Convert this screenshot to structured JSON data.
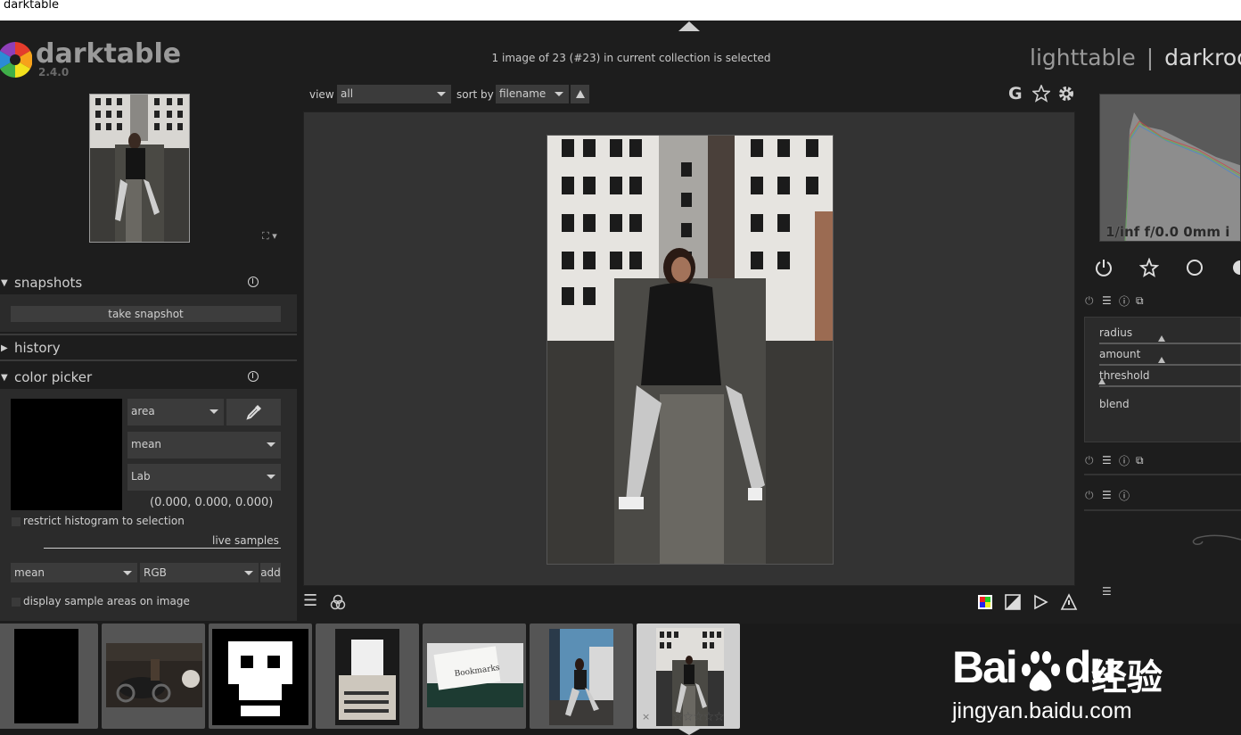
{
  "window": {
    "title": "darktable"
  },
  "header": {
    "app_name": "darktable",
    "version": "2.4.0",
    "status": "1 image of 23 (#23) in current collection is selected",
    "views": {
      "lighttable": "lighttable",
      "separator": "|",
      "darkroom": "darkroom"
    }
  },
  "left": {
    "snapshots": {
      "title": "snapshots",
      "take_snapshot": "take snapshot"
    },
    "history": {
      "title": "history"
    },
    "color_picker": {
      "title": "color picker",
      "mode": "area",
      "stat": "mean",
      "colorspace": "Lab",
      "values": "(0.000, 0.000, 0.000)",
      "restrict_label": "restrict histogram to selection",
      "live_samples": "live samples",
      "sample_stat": "mean",
      "sample_space": "RGB",
      "add": "add",
      "display_label": "display sample areas on image"
    }
  },
  "toolbar": {
    "view_label": "view",
    "view_value": "all",
    "sort_label": "sort by",
    "sort_value": "filename",
    "g_label": "G"
  },
  "right": {
    "histogram_info": "1/inf f/0.0 0mm i",
    "sliders": [
      {
        "label": "radius",
        "value": 0.45
      },
      {
        "label": "amount",
        "value": 0.45
      },
      {
        "label": "threshold",
        "value": 0.02
      }
    ],
    "blend_label": "blend"
  },
  "filmstrip": {
    "watermark_letter": "j",
    "cells": [
      {
        "label": "black frame"
      },
      {
        "label": "motorcycle"
      },
      {
        "label": "pixel face"
      },
      {
        "label": "typewriter"
      },
      {
        "label": "Bookmarks",
        "text": "Bookmarks"
      },
      {
        "label": "woman city"
      },
      {
        "label": "woman wall",
        "selected": true
      }
    ],
    "stars": "☆☆☆☆☆",
    "reject": "×"
  },
  "watermark": {
    "brand": "Bai",
    "brand2": "du",
    "cn": "经验",
    "url": "jingyan.baidu.com"
  },
  "colors": {
    "background": "#1d1d1d",
    "panel": "#2b2b2b",
    "center": "#333333",
    "text": "#cfcfcf"
  }
}
